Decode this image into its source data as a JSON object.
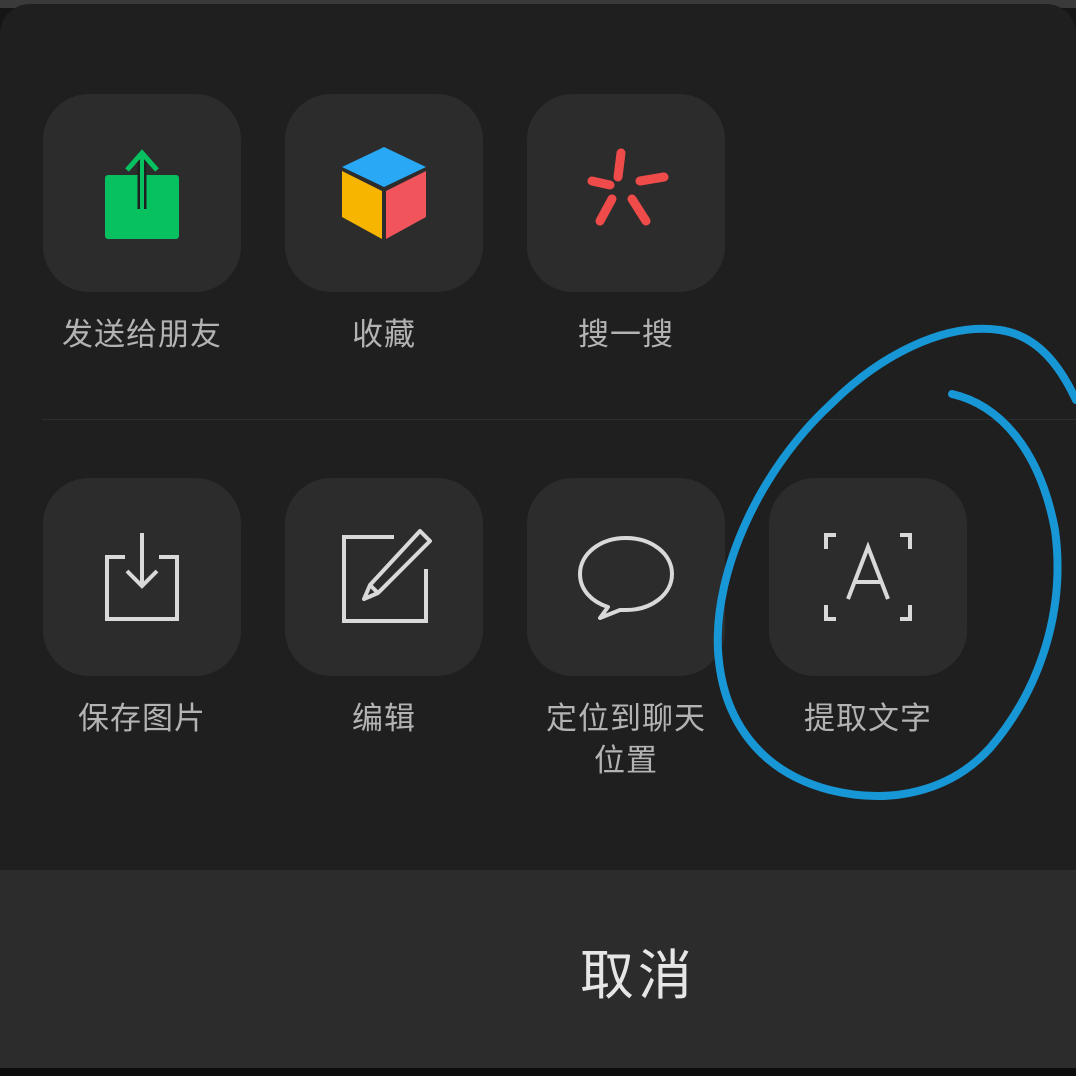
{
  "actions_row1": [
    {
      "label": "发送给朋友",
      "icon": "share-upload-icon"
    },
    {
      "label": "收藏",
      "icon": "favorites-cube-icon"
    },
    {
      "label": "搜一搜",
      "icon": "search-sparkle-icon"
    }
  ],
  "actions_row2": [
    {
      "label": "保存图片",
      "icon": "download-tray-icon"
    },
    {
      "label": "编辑",
      "icon": "edit-pencil-icon"
    },
    {
      "label": "定位到聊天\n位置",
      "icon": "chat-bubble-icon"
    },
    {
      "label": "提取文字",
      "icon": "text-scan-icon"
    }
  ],
  "cancel": {
    "label": "取消"
  },
  "colors": {
    "sheet": "#1f1f1f",
    "tile": "#2c2c2c",
    "label": "#b3b3b3",
    "share_green": "#07c160",
    "cube_blue": "#29a8f5",
    "cube_yellow": "#f7b500",
    "cube_red": "#f2545b",
    "search_red": "#f04b4b",
    "annotation_blue": "#1797d6"
  }
}
